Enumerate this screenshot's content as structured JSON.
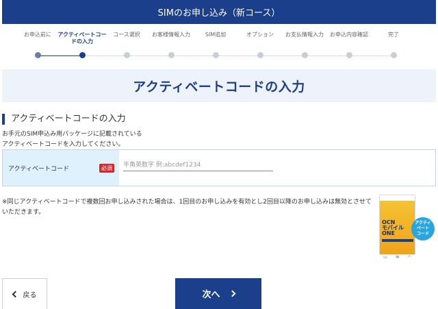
{
  "header": {
    "title": "SIMのお申し込み（新コース）"
  },
  "steps": [
    {
      "label": "お申込前に",
      "state": "done"
    },
    {
      "label": "アクティベートコードの入力",
      "state": "active"
    },
    {
      "label": "コース選択",
      "state": "todo"
    },
    {
      "label": "お客様情報入力",
      "state": "todo"
    },
    {
      "label": "SIM追加",
      "state": "todo"
    },
    {
      "label": "オプション",
      "state": "todo"
    },
    {
      "label": "お支払情報入力",
      "state": "todo"
    },
    {
      "label": "お申込内容確認",
      "state": "todo"
    },
    {
      "label": "完了",
      "state": "todo"
    }
  ],
  "page_title": "アクティベートコードの入力",
  "section": {
    "heading": "アクティベートコードの入力",
    "intro_line1": "お手元のSIM申込み用パッケージに記載されている",
    "intro_line2": "アクティベートコードを入力してください。"
  },
  "form": {
    "label": "アクティベートコード",
    "required": "必須",
    "placeholder": "半角英数字 例:abcdef1234",
    "value": ""
  },
  "note": "※同じアクティベートコードで複数回お申し込みされた場合は、1回目のお申し込みを有効とし2回目以降のお申し込みは無効とさせていただきます。",
  "package": {
    "logo_line1": "OCN",
    "logo_line2": "モバイル",
    "logo_line3": "ONE",
    "badge_line1": "アクティ",
    "badge_line2": "ベート",
    "badge_line3": "コード"
  },
  "buttons": {
    "back": "戻る",
    "next": "次へ"
  },
  "colors": {
    "primary": "#1c3f8c",
    "title_band": "#eef3fb",
    "label_bg": "#dff1fc",
    "required": "#d4292c",
    "badge": "#2aa5e2"
  }
}
